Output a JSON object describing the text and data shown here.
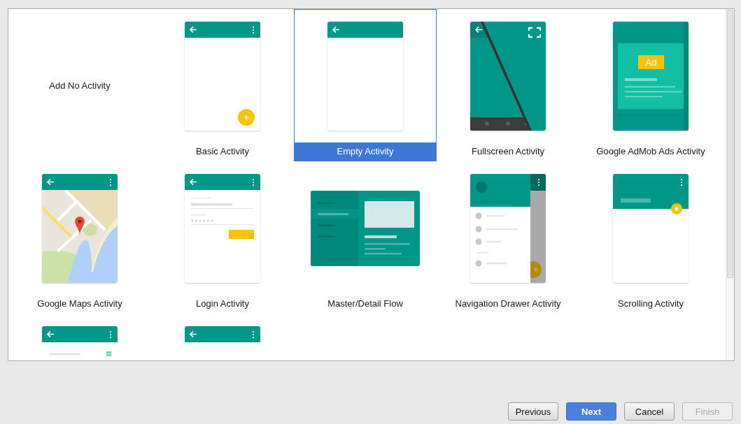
{
  "templates": [
    {
      "label": "Add No Activity",
      "kind": "none",
      "selected": false
    },
    {
      "label": "Basic Activity",
      "kind": "basic",
      "selected": false
    },
    {
      "label": "Empty Activity",
      "kind": "empty",
      "selected": true
    },
    {
      "label": "Fullscreen Activity",
      "kind": "fullscreen",
      "selected": false
    },
    {
      "label": "Google AdMob Ads Activity",
      "kind": "admob",
      "badge": "Ad",
      "selected": false
    },
    {
      "label": "Google Maps Activity",
      "kind": "maps",
      "selected": false
    },
    {
      "label": "Login Activity",
      "kind": "login",
      "selected": false
    },
    {
      "label": "Master/Detail Flow",
      "kind": "master-detail",
      "selected": false
    },
    {
      "label": "Navigation Drawer Activity",
      "kind": "nav-drawer",
      "selected": false
    },
    {
      "label": "Scrolling Activity",
      "kind": "scrolling",
      "selected": false
    },
    {
      "kind": "checklist",
      "selected": false
    },
    {
      "kind": "menu",
      "selected": false
    }
  ],
  "buttons": [
    {
      "label": "Previous",
      "kind": "normal",
      "disabled": false
    },
    {
      "label": "Next",
      "kind": "primary",
      "disabled": false
    },
    {
      "label": "Cancel",
      "kind": "normal",
      "disabled": false
    },
    {
      "label": "Finish",
      "kind": "normal",
      "disabled": true
    }
  ]
}
